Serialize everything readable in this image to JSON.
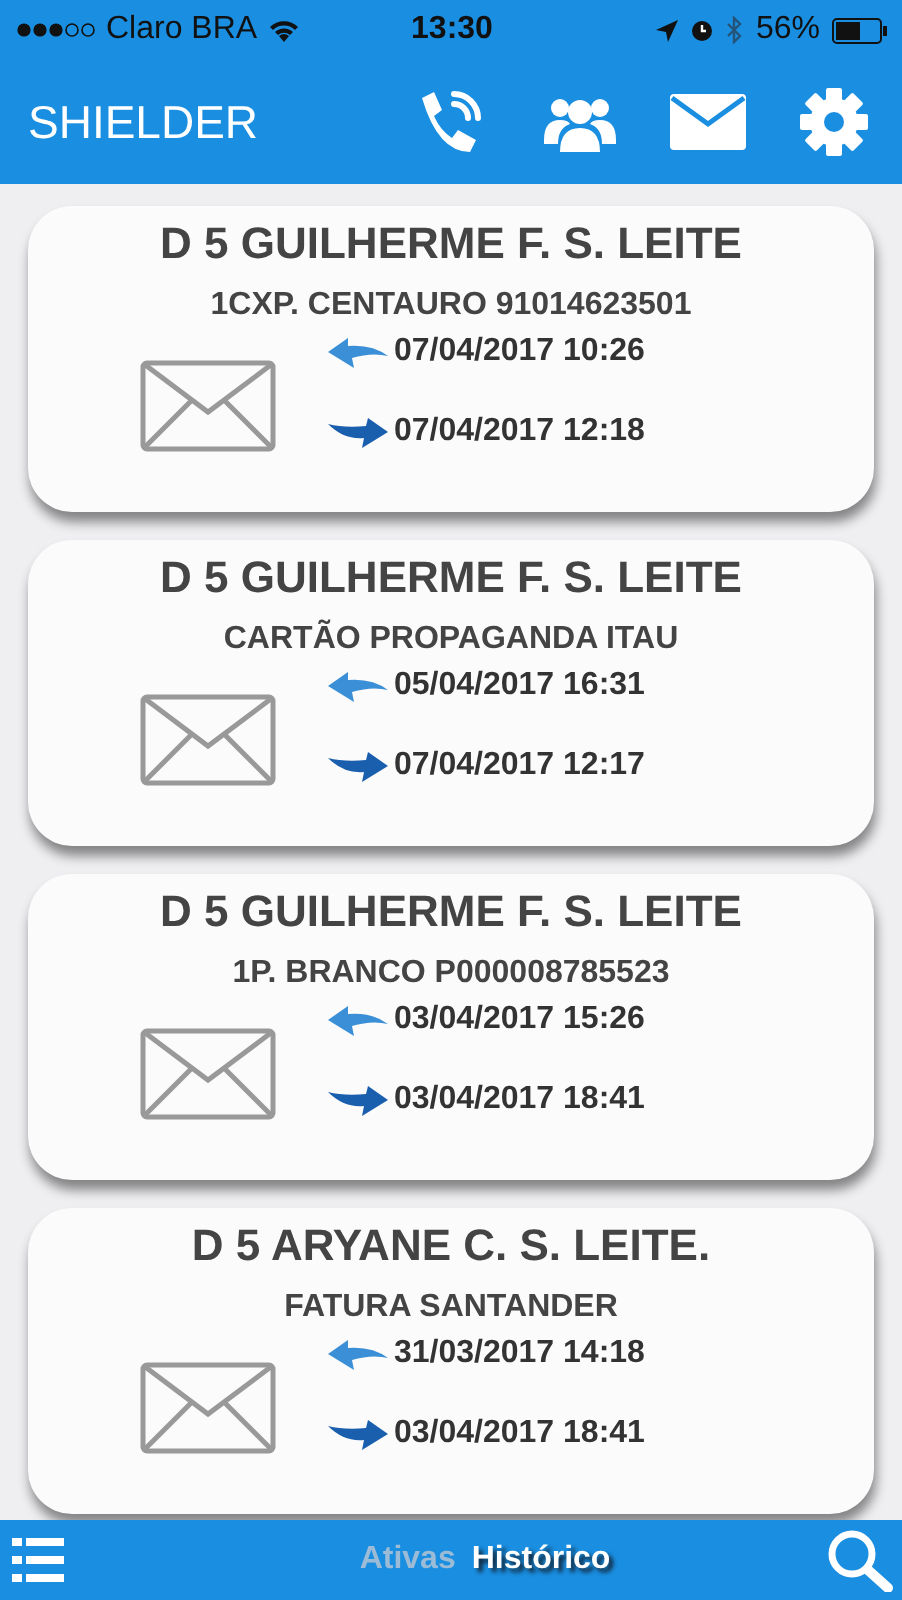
{
  "status_bar": {
    "carrier": "Claro BRA",
    "time": "13:30",
    "battery": "56%"
  },
  "header": {
    "title": "SHIELDER"
  },
  "cards": [
    {
      "name": "D 5 GUILHERME F. S. LEITE",
      "item": "1CXP. CENTAURO 91014623501",
      "received": "07/04/2017 10:26",
      "delivered": "07/04/2017 12:18"
    },
    {
      "name": "D 5 GUILHERME F. S. LEITE",
      "item": "CARTÃO PROPAGANDA ITAU",
      "received": "05/04/2017 16:31",
      "delivered": "07/04/2017 12:17"
    },
    {
      "name": "D 5 GUILHERME F. S. LEITE",
      "item": "1P. BRANCO P000008785523",
      "received": "03/04/2017 15:26",
      "delivered": "03/04/2017 18:41"
    },
    {
      "name": "D 5 ARYANE C. S. LEITE.",
      "item": "FATURA SANTANDER",
      "received": "31/03/2017 14:18",
      "delivered": "03/04/2017 18:41"
    }
  ],
  "tabs": [
    {
      "label": "Ativas",
      "selected": false
    },
    {
      "label": "Histórico",
      "selected": true
    }
  ]
}
